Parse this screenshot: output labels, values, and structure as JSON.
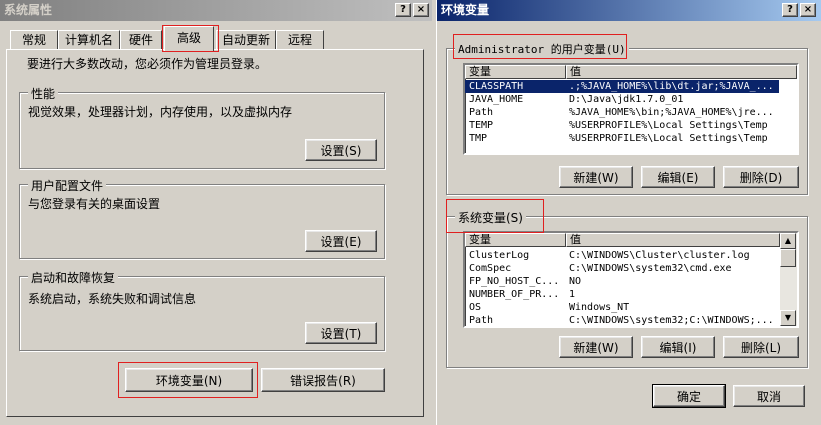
{
  "left_window": {
    "title": "系统属性",
    "tabs": [
      "常规",
      "计算机名",
      "硬件",
      "高级",
      "自动更新",
      "远程"
    ],
    "notice": "要进行大多数改动，您必须作为管理员登录。",
    "performance": {
      "title": "性能",
      "desc": "视觉效果，处理器计划，内存使用，以及虚拟内存",
      "button": "设置(S)"
    },
    "profiles": {
      "title": "用户配置文件",
      "desc": "与您登录有关的桌面设置",
      "button": "设置(E)"
    },
    "startup": {
      "title": "启动和故障恢复",
      "desc": "系统启动，系统失败和调试信息",
      "button": "设置(T)"
    },
    "env_button": "环境变量(N)",
    "error_button": "错误报告(R)"
  },
  "right_window": {
    "title": "环境变量",
    "user_group": "Administrator 的用户变量(U)",
    "system_group": "系统变量(S)",
    "col_var": "变量",
    "col_val": "值",
    "user_vars": [
      {
        "name": "CLASSPATH",
        "value": ".;%JAVA_HOME%\\lib\\dt.jar;%JAVA_..."
      },
      {
        "name": "JAVA_HOME",
        "value": "D:\\Java\\jdk1.7.0_01"
      },
      {
        "name": "Path",
        "value": "%JAVA_HOME%\\bin;%JAVA_HOME%\\jre..."
      },
      {
        "name": "TEMP",
        "value": "%USERPROFILE%\\Local Settings\\Temp"
      },
      {
        "name": "TMP",
        "value": "%USERPROFILE%\\Local Settings\\Temp"
      }
    ],
    "system_vars": [
      {
        "name": "ClusterLog",
        "value": "C:\\WINDOWS\\Cluster\\cluster.log"
      },
      {
        "name": "ComSpec",
        "value": "C:\\WINDOWS\\system32\\cmd.exe"
      },
      {
        "name": "FP_NO_HOST_C...",
        "value": "NO"
      },
      {
        "name": "NUMBER_OF_PR...",
        "value": "1"
      },
      {
        "name": "OS",
        "value": "Windows_NT"
      },
      {
        "name": "Path",
        "value": "C:\\WINDOWS\\system32;C:\\WINDOWS;..."
      }
    ],
    "user_buttons": {
      "new": "新建(W)",
      "edit": "编辑(E)",
      "delete": "删除(D)"
    },
    "system_buttons": {
      "new": "新建(W)",
      "edit": "编辑(I)",
      "delete": "删除(L)"
    },
    "ok": "确定",
    "cancel": "取消"
  },
  "titlebar_buttons": {
    "help": "?",
    "close": "×"
  },
  "colors": {
    "highlight": "#0a246a",
    "annotation": "#e02020",
    "face": "#d4d0c8"
  }
}
